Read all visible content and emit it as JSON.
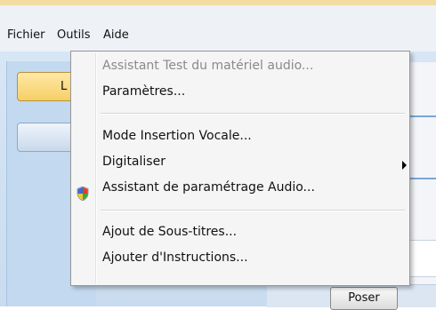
{
  "menubar": {
    "items": [
      "Fichier",
      "Outils",
      "Aide"
    ]
  },
  "left_button_label": "L",
  "bottom_button_label": "Poser",
  "context_menu": {
    "items": [
      {
        "label": "Assistant Test du matériel audio...",
        "disabled": true
      },
      {
        "label": "Paramètres...",
        "disabled": false
      },
      {
        "label": "Mode Insertion Vocale...",
        "disabled": false
      },
      {
        "label": "Digitaliser",
        "disabled": false,
        "submenu": true
      },
      {
        "label": "Assistant de paramétrage Audio...",
        "disabled": false,
        "icon": "shield-icon"
      },
      {
        "label": "Ajout de Sous-titres...",
        "disabled": false
      },
      {
        "label": "Ajouter d'Instructions...",
        "disabled": false
      }
    ]
  },
  "colors": {
    "menu_background": "#f5f5f5",
    "disabled_text": "#8a8a8a",
    "accent_button": "#f6cf66",
    "app_background": "#c9dcef"
  }
}
